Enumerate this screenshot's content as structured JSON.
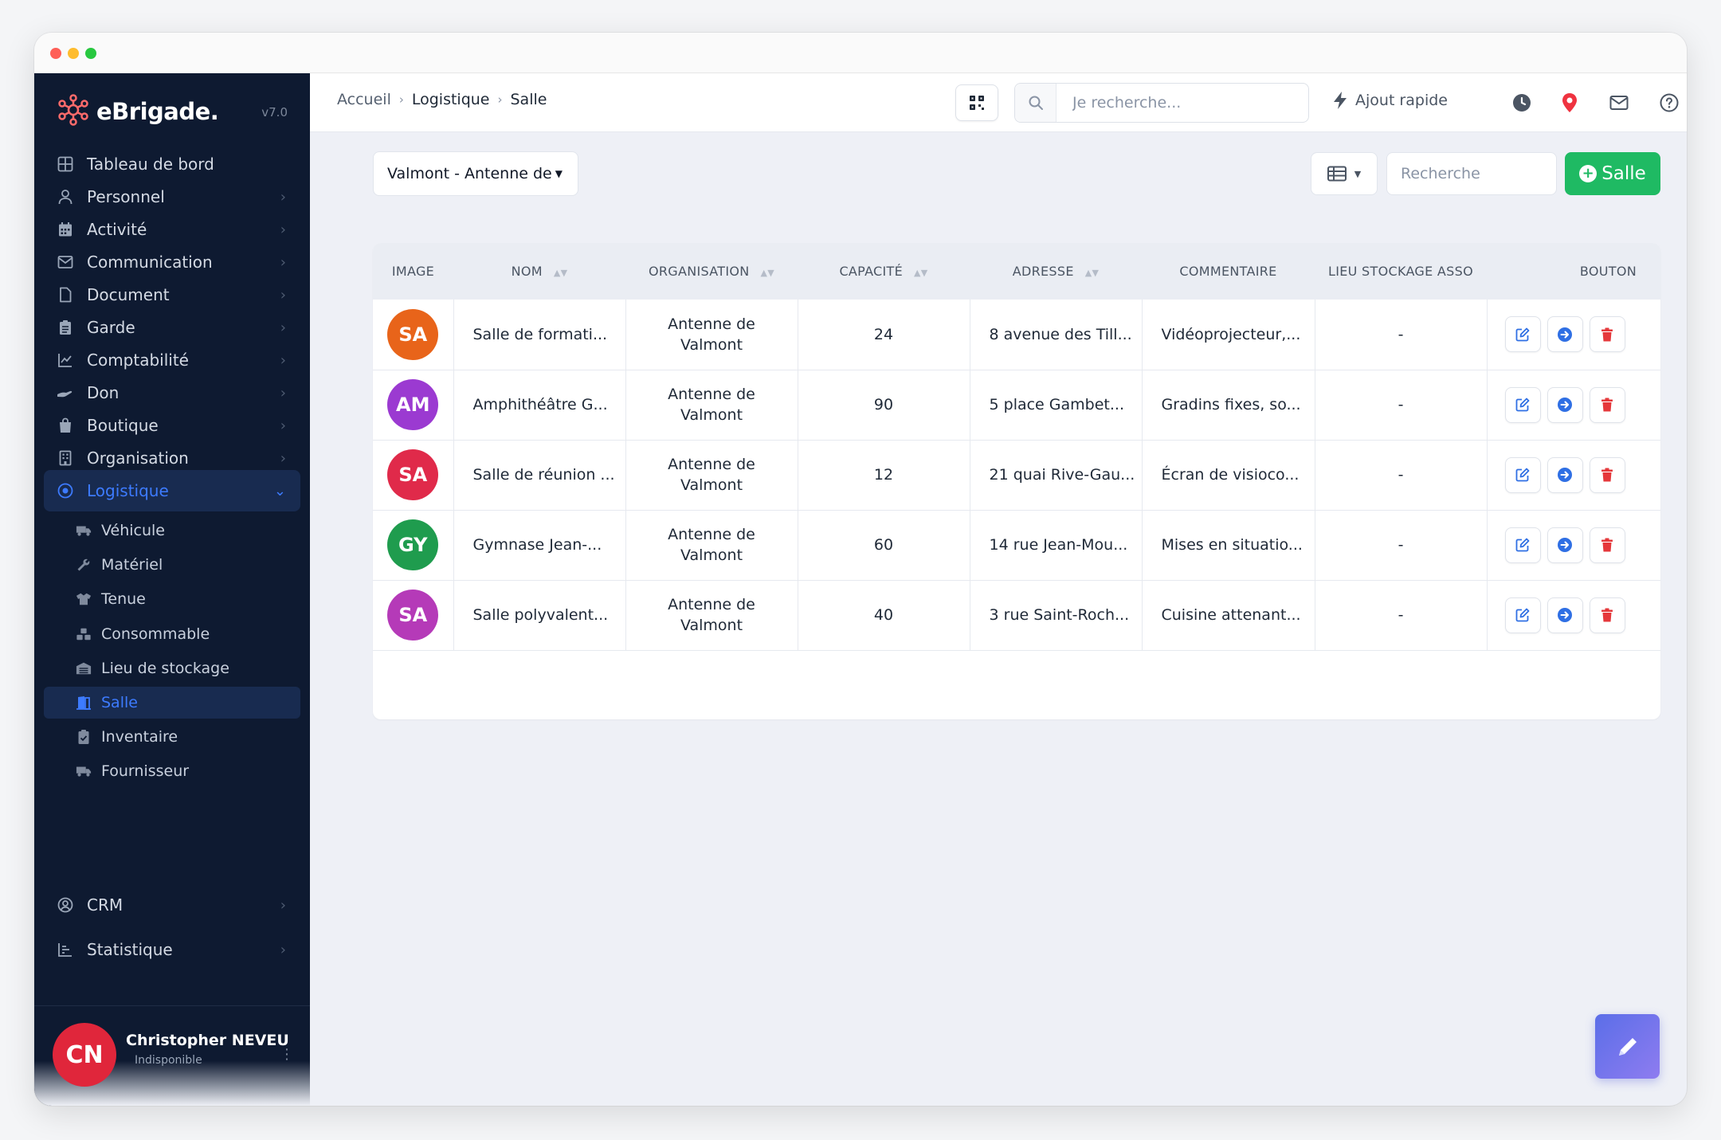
{
  "window": {
    "dots": [
      "#fe5f57",
      "#febc2e",
      "#28c840"
    ]
  },
  "brand": {
    "name": "eBrigade.",
    "version": "v7.0",
    "accent": "#ff6b6b"
  },
  "sidebar": {
    "items": [
      {
        "label": "Tableau de bord",
        "icon": "dashboard-icon"
      },
      {
        "label": "Personnel",
        "icon": "user-icon"
      },
      {
        "label": "Activité",
        "icon": "calendar-icon"
      },
      {
        "label": "Communication",
        "icon": "mail-icon"
      },
      {
        "label": "Document",
        "icon": "document-icon"
      },
      {
        "label": "Garde",
        "icon": "clipboard-icon"
      },
      {
        "label": "Comptabilité",
        "icon": "chart-line-icon"
      },
      {
        "label": "Don",
        "icon": "hand-icon"
      },
      {
        "label": "Boutique",
        "icon": "shopping-bag-icon"
      },
      {
        "label": "Organisation",
        "icon": "building-icon"
      },
      {
        "label": "Logistique",
        "icon": "target-icon"
      }
    ],
    "sub_items": [
      {
        "label": "Véhicule",
        "icon": "truck-icon"
      },
      {
        "label": "Matériel",
        "icon": "wrench-icon"
      },
      {
        "label": "Tenue",
        "icon": "shirt-icon"
      },
      {
        "label": "Consommable",
        "icon": "boxes-icon"
      },
      {
        "label": "Lieu de stockage",
        "icon": "warehouse-icon"
      },
      {
        "label": "Salle",
        "icon": "door-icon"
      },
      {
        "label": "Inventaire",
        "icon": "clipboard-check-icon"
      },
      {
        "label": "Fournisseur",
        "icon": "truck-icon"
      }
    ],
    "bottom_items": [
      {
        "label": "CRM",
        "icon": "user-circle-icon"
      },
      {
        "label": "Statistique",
        "icon": "bar-chart-icon"
      }
    ]
  },
  "user": {
    "initials": "CN",
    "name": "Christopher NEVEU",
    "status": "Indisponible",
    "avatar_color": "#e0263b"
  },
  "header": {
    "breadcrumb": [
      "Accueil",
      "Logistique",
      "Salle"
    ],
    "search_placeholder": "Je recherche...",
    "quick_add_label": "Ajout rapide"
  },
  "toolbar": {
    "org_select": "Valmont - Antenne de",
    "list_search_placeholder": "Recherche",
    "add_label": "Salle"
  },
  "table": {
    "columns": [
      "IMAGE",
      "NOM",
      "ORGANISATION",
      "CAPACITÉ",
      "ADRESSE",
      "COMMENTAIRE",
      "LIEU STOCKAGE ASSO",
      "BOUTON"
    ],
    "rows": [
      {
        "initials": "SA",
        "color": "#e8641a",
        "nom": "Salle de formati...",
        "org": "Antenne de Valmont",
        "capacite": "24",
        "adresse": "8 avenue des Till...",
        "commentaire": "Vidéoprojecteur,...",
        "lieu": "-"
      },
      {
        "initials": "AM",
        "color": "#9b3ad1",
        "nom": "Amphithéâtre G...",
        "org": "Antenne de Valmont",
        "capacite": "90",
        "adresse": "5 place Gambet...",
        "commentaire": "Gradins fixes, so...",
        "lieu": "-"
      },
      {
        "initials": "SA",
        "color": "#e02a4a",
        "nom": "Salle de réunion ...",
        "org": "Antenne de Valmont",
        "capacite": "12",
        "adresse": "21 quai Rive-Gau...",
        "commentaire": "Écran de visioco...",
        "lieu": "-"
      },
      {
        "initials": "GY",
        "color": "#1f9c4e",
        "nom": "Gymnase Jean-...",
        "org": "Antenne de Valmont",
        "capacite": "60",
        "adresse": "14 rue Jean-Mou...",
        "commentaire": "Mises en situatio...",
        "lieu": "-"
      },
      {
        "initials": "SA",
        "color": "#b53ab8",
        "nom": "Salle polyvalent...",
        "org": "Antenne de Valmont",
        "capacite": "40",
        "adresse": "3 rue Saint-Roch...",
        "commentaire": "Cuisine attenant...",
        "lieu": "-"
      }
    ]
  },
  "colors": {
    "success": "#1fba63",
    "primary": "#3d7bff",
    "danger": "#e5383b",
    "sidebar_bg": "#0e1a31"
  }
}
